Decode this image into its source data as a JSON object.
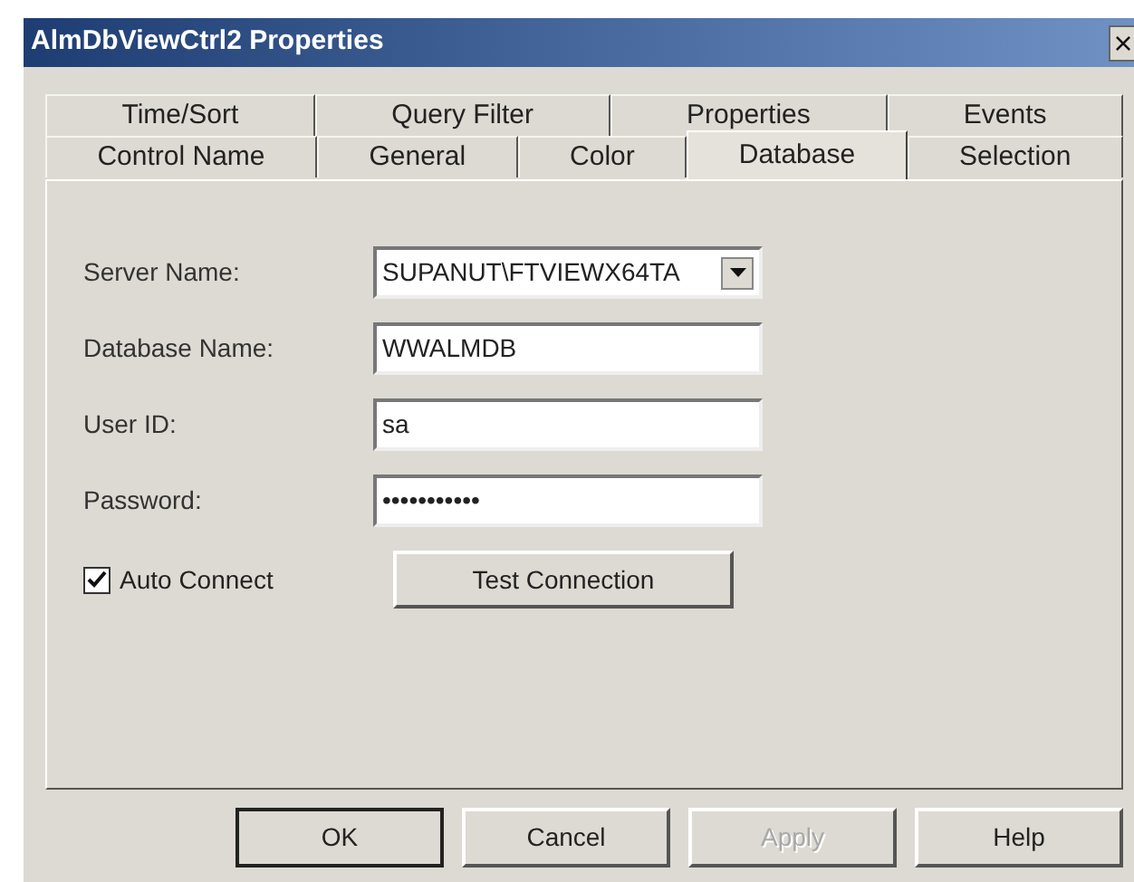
{
  "window": {
    "title": "AlmDbViewCtrl2 Properties",
    "close": "×"
  },
  "tab_rows": [
    [
      {
        "label": "Time/Sort",
        "selected": false
      },
      {
        "label": "Query Filter",
        "selected": false
      },
      {
        "label": "Properties",
        "selected": false
      },
      {
        "label": "Events",
        "selected": false
      }
    ],
    [
      {
        "label": "Control Name",
        "selected": false
      },
      {
        "label": "General",
        "selected": false
      },
      {
        "label": "Color",
        "selected": false
      },
      {
        "label": "Database",
        "selected": true
      },
      {
        "label": "Selection",
        "selected": false
      }
    ]
  ],
  "fields": [
    {
      "label": "Server Name:",
      "kind": "dropdown",
      "value": "SUPANUT\\FTVIEWX64TA"
    },
    {
      "label": "Database Name:",
      "kind": "text",
      "value": "WWALMDB"
    },
    {
      "label": "User ID:",
      "kind": "text",
      "value": "sa"
    },
    {
      "label": "Password:",
      "kind": "text",
      "value": "•••••••••••"
    }
  ],
  "auto_connect": {
    "label": "Auto Connect",
    "checked": true
  },
  "test_button": "Test Connection",
  "buttons": [
    {
      "label": "OK",
      "default": true,
      "disabled": false
    },
    {
      "label": "Cancel",
      "default": false,
      "disabled": false
    },
    {
      "label": "Apply",
      "default": false,
      "disabled": true
    },
    {
      "label": "Help",
      "default": false,
      "disabled": false
    }
  ]
}
